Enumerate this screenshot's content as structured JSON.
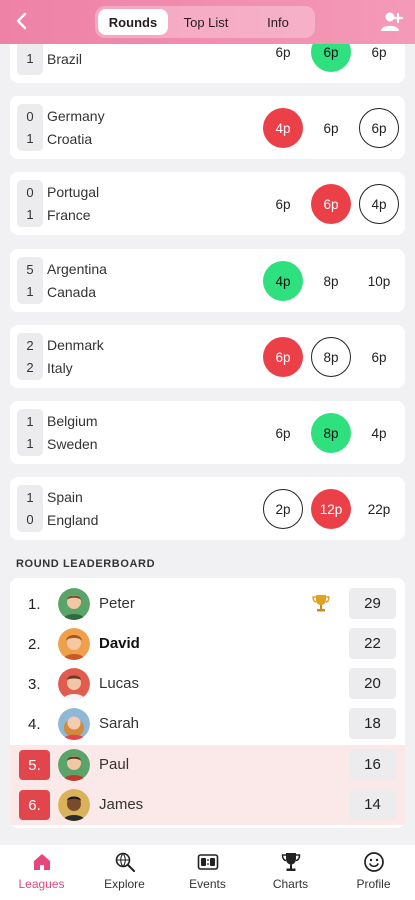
{
  "header": {
    "tabs": [
      {
        "label": "Rounds",
        "active": true
      },
      {
        "label": "Top List",
        "active": false
      },
      {
        "label": "Info",
        "active": false
      }
    ]
  },
  "matches": [
    {
      "home": "",
      "away": "Brazil",
      "home_score": "",
      "away_score": "1",
      "picks": [
        {
          "label": "6p",
          "style": "plain"
        },
        {
          "label": "6p",
          "style": "green"
        },
        {
          "label": "6p",
          "style": "plain"
        }
      ]
    },
    {
      "home": "Germany",
      "away": "Croatia",
      "home_score": "0",
      "away_score": "1",
      "picks": [
        {
          "label": "4p",
          "style": "red"
        },
        {
          "label": "6p",
          "style": "plain"
        },
        {
          "label": "6p",
          "style": "ring"
        }
      ]
    },
    {
      "home": "Portugal",
      "away": "France",
      "home_score": "0",
      "away_score": "1",
      "picks": [
        {
          "label": "6p",
          "style": "plain"
        },
        {
          "label": "6p",
          "style": "red"
        },
        {
          "label": "4p",
          "style": "ring"
        }
      ]
    },
    {
      "home": "Argentina",
      "away": "Canada",
      "home_score": "5",
      "away_score": "1",
      "picks": [
        {
          "label": "4p",
          "style": "green"
        },
        {
          "label": "8p",
          "style": "plain"
        },
        {
          "label": "10p",
          "style": "plain"
        }
      ]
    },
    {
      "home": "Denmark",
      "away": "Italy",
      "home_score": "2",
      "away_score": "2",
      "picks": [
        {
          "label": "6p",
          "style": "red"
        },
        {
          "label": "8p",
          "style": "ring"
        },
        {
          "label": "6p",
          "style": "plain"
        }
      ]
    },
    {
      "home": "Belgium",
      "away": "Sweden",
      "home_score": "1",
      "away_score": "1",
      "picks": [
        {
          "label": "6p",
          "style": "plain"
        },
        {
          "label": "8p",
          "style": "green"
        },
        {
          "label": "4p",
          "style": "plain"
        }
      ]
    },
    {
      "home": "Spain",
      "away": "England",
      "home_score": "1",
      "away_score": "0",
      "picks": [
        {
          "label": "2p",
          "style": "ring"
        },
        {
          "label": "12p",
          "style": "red"
        },
        {
          "label": "22p",
          "style": "plain"
        }
      ]
    }
  ],
  "leaderboard": {
    "title": "ROUND LEADERBOARD",
    "rows": [
      {
        "rank": "1.",
        "name": "Peter",
        "score": "29",
        "trophy": true,
        "highlight": false,
        "bold": false,
        "avatar": "green"
      },
      {
        "rank": "2.",
        "name": "David",
        "score": "22",
        "trophy": false,
        "highlight": false,
        "bold": true,
        "avatar": "orange"
      },
      {
        "rank": "3.",
        "name": "Lucas",
        "score": "20",
        "trophy": false,
        "highlight": false,
        "bold": false,
        "avatar": "red"
      },
      {
        "rank": "4.",
        "name": "Sarah",
        "score": "18",
        "trophy": false,
        "highlight": false,
        "bold": false,
        "avatar": "blue"
      },
      {
        "rank": "5.",
        "name": "Paul",
        "score": "16",
        "trophy": false,
        "highlight": true,
        "bold": false,
        "avatar": "green"
      },
      {
        "rank": "6.",
        "name": "James",
        "score": "14",
        "trophy": false,
        "highlight": true,
        "bold": false,
        "avatar": "dark"
      }
    ]
  },
  "nav": {
    "items": [
      {
        "label": "Leagues",
        "icon": "home-icon",
        "active": true
      },
      {
        "label": "Explore",
        "icon": "globe-search-icon",
        "active": false
      },
      {
        "label": "Events",
        "icon": "scoreboard-icon",
        "active": false
      },
      {
        "label": "Charts",
        "icon": "trophy-icon",
        "active": false
      },
      {
        "label": "Profile",
        "icon": "smiley-icon",
        "active": false
      }
    ]
  },
  "colors": {
    "accent": "#e8457c",
    "header_gradient_start": "#ee82a6",
    "pick_red": "#ec4048",
    "pick_green": "#2ee07e",
    "highlight_rank": "#e0464c",
    "highlight_row": "#fbe9e9"
  }
}
